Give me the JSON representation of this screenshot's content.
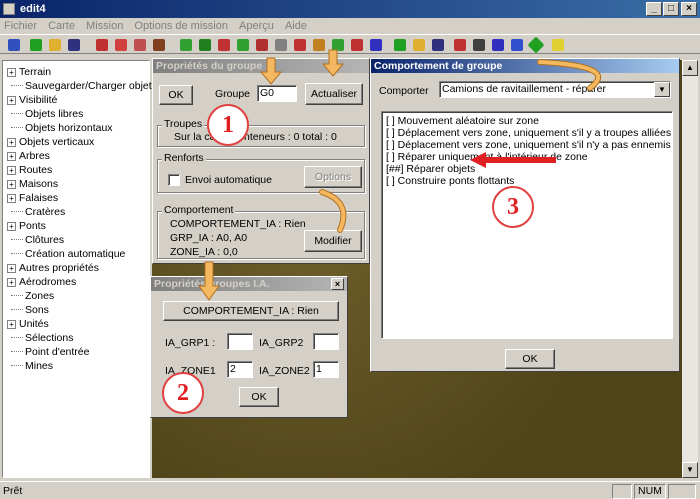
{
  "window": {
    "title": "edit4",
    "min": "_",
    "max": "□",
    "close": "×"
  },
  "menu": [
    "Fichier",
    "Carte",
    "Mission",
    "Options de mission",
    "Aperçu",
    "Aide"
  ],
  "tree": [
    {
      "label": "Terrain",
      "exp": "+"
    },
    {
      "label": "Sauvegarder/Charger objets",
      "exp": ""
    },
    {
      "label": "Visibilité",
      "exp": "+"
    },
    {
      "label": "Objets libres",
      "exp": ""
    },
    {
      "label": "Objets horizontaux",
      "exp": ""
    },
    {
      "label": "Objets verticaux",
      "exp": "+"
    },
    {
      "label": "Arbres",
      "exp": "+"
    },
    {
      "label": "Routes",
      "exp": "+"
    },
    {
      "label": "Maisons",
      "exp": "+"
    },
    {
      "label": "Falaises",
      "exp": "+"
    },
    {
      "label": "Cratères",
      "exp": ""
    },
    {
      "label": "Ponts",
      "exp": "+"
    },
    {
      "label": "Clôtures",
      "exp": ""
    },
    {
      "label": "Création automatique",
      "exp": ""
    },
    {
      "label": "Autres propriétés",
      "exp": "+"
    },
    {
      "label": "Aérodromes",
      "exp": "+"
    },
    {
      "label": "Zones",
      "exp": ""
    },
    {
      "label": "Sons",
      "exp": ""
    },
    {
      "label": "Unités",
      "exp": "+"
    },
    {
      "label": "Sélections",
      "exp": ""
    },
    {
      "label": "Point d'entrée",
      "exp": ""
    },
    {
      "label": "Mines",
      "exp": ""
    }
  ],
  "groupProps": {
    "title": "Propriétés du groupe",
    "ok": "OK",
    "groupeLabel": "Groupe",
    "groupeValue": "G0",
    "actualiser": "Actualiser",
    "troupesTitle": "Troupes",
    "troupesText": "Sur la carte/Conteneurs : 0 total : 0",
    "renfortsTitle": "Renforts",
    "envoiAuto": "Envoi automatique",
    "options": "Options",
    "comportementTitle": "Comportement",
    "comportementIA": "COMPORTEMENT_IA : Rien",
    "grpIA": "GRP_IA : A0, A0",
    "zoneIA": "ZONE_IA : 0,0",
    "modifier": "Modifier"
  },
  "iaProps": {
    "title": "Propriétés groupes I.A.",
    "comportementBtn": "COMPORTEMENT_IA : Rien",
    "grp1Label": "IA_GRP1 :",
    "grp1Value": "",
    "grp2Label": "IA_GRP2",
    "grp2Value": "",
    "zone1Label": "IA_ZONE1",
    "zone1Value": "2",
    "zone2Label": "IA_ZONE2",
    "zone2Value": "1",
    "ok": "OK"
  },
  "behavior": {
    "title": "Comportement de groupe",
    "comporterLabel": "Comporter",
    "selected": "Camions de ravitaillement - réparer",
    "items": [
      "[ ] Mouvement aléatoire sur zone",
      "[ ] Déplacement vers zone, uniquement s'il y a troupes alliées",
      "[ ] Déplacement vers zone, uniquement s'il n'y a pas ennemis",
      "[ ] Réparer uniquement à l'intérieur de zone",
      "[##] Réparer objets",
      "[ ] Construire ponts flottants"
    ],
    "ok": "OK"
  },
  "annotations": {
    "one": "1",
    "two": "2",
    "three": "3"
  },
  "status": {
    "text": "Prêt",
    "num": "NUM"
  },
  "colors": {
    "titleActive": "#0a246a",
    "annotationRed": "#e02020",
    "arrowOrange": "#f4b860"
  }
}
